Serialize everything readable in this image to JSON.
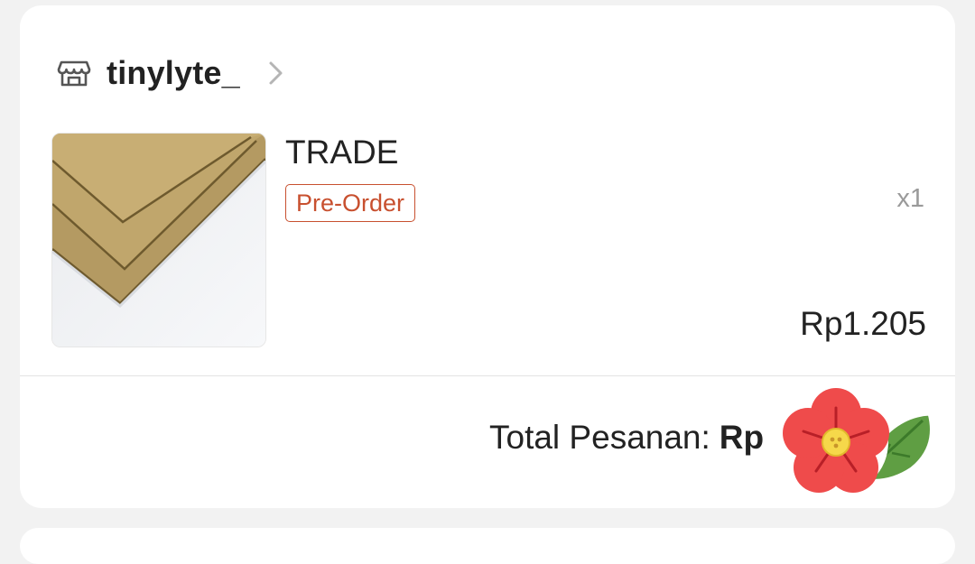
{
  "shop": {
    "name": "tinylyte_",
    "icon": "storefront-icon",
    "chevron_icon": "chevron-right-icon"
  },
  "product": {
    "title": "TRADE",
    "badge": "Pre-Order",
    "quantity": "x1",
    "price": "Rp1.205",
    "image": "cardboard-sheets-thumbnail"
  },
  "summary": {
    "label": "Total Pesanan:",
    "amount_visible": "Rp",
    "chevron_icon": "chevron-down-icon"
  },
  "overlay": {
    "sticker": "flower-sticker-icon"
  },
  "colors": {
    "accent": "#c8502f",
    "text": "#222222",
    "muted": "#9a9a9a",
    "background": "#f2f2f2",
    "card": "#ffffff"
  }
}
